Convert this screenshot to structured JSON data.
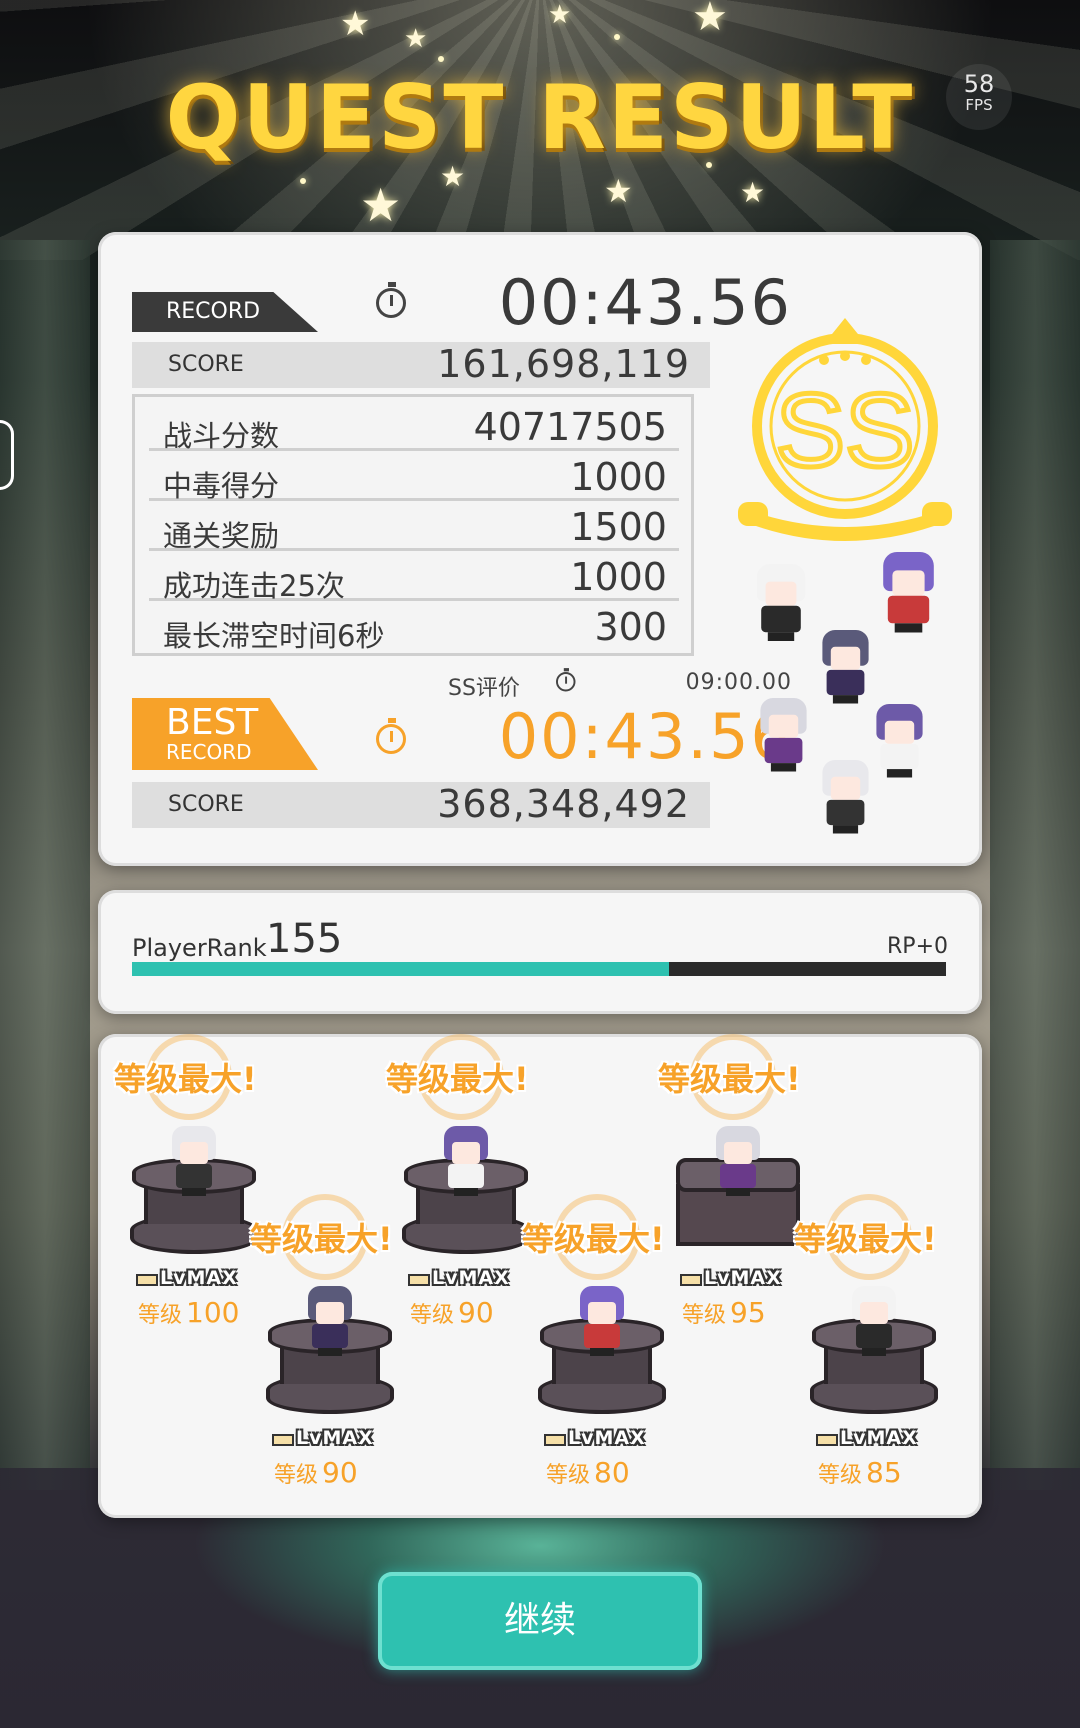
{
  "title": "QUEST RESULT",
  "fps": {
    "value": "58",
    "label": "FPS"
  },
  "record": {
    "tag": "RECORD",
    "time": "00:43.56",
    "score_label": "SCORE",
    "score": "161,698,119"
  },
  "details": [
    {
      "label": "战斗分数",
      "value": "40717505"
    },
    {
      "label": "中毒得分",
      "value": "1000"
    },
    {
      "label": "通关奖励",
      "value": "1500"
    },
    {
      "label": "成功连击25次",
      "value": "1000"
    },
    {
      "label": "最长滞空时间6秒",
      "value": "300"
    }
  ],
  "ss_condition": {
    "label": "SS评价",
    "time": "09:00.00"
  },
  "best": {
    "tag_line1": "BEST",
    "tag_line2": "RECORD",
    "time": "00:43.56",
    "score_label": "SCORE",
    "score": "368,348,492"
  },
  "grade": "SS",
  "player_rank": {
    "label": "PlayerRank",
    "value": "155",
    "rp": "RP+0",
    "progress": 0.66
  },
  "units": [
    {
      "banner": "等级最大!",
      "tag": "LvMAX",
      "level_label": "等级",
      "level": "100",
      "hair": "#e8e8ec",
      "outfit": "#333"
    },
    {
      "banner": "等级最大!",
      "tag": "LvMAX",
      "level_label": "等级",
      "level": "90",
      "hair": "#5a5a7a",
      "outfit": "#3a2f5a"
    },
    {
      "banner": "等级最大!",
      "tag": "LvMAX",
      "level_label": "等级",
      "level": "90",
      "hair": "#6d5aa8",
      "outfit": "#f3f3f3"
    },
    {
      "banner": "等级最大!",
      "tag": "LvMAX",
      "level_label": "等级",
      "level": "80",
      "hair": "#7a64c8",
      "outfit": "#c83a3a"
    },
    {
      "banner": "等级最大!",
      "tag": "LvMAX",
      "level_label": "等级",
      "level": "95",
      "hair": "#d8d8e0",
      "outfit": "#6a3a8a"
    },
    {
      "banner": "等级最大!",
      "tag": "LvMAX",
      "level_label": "等级",
      "level": "85",
      "hair": "#f3f3f3",
      "outfit": "#2a2a2a"
    }
  ],
  "continue_label": "继续",
  "colors": {
    "accent_orange": "#f7a229",
    "accent_teal": "#2ec1b0",
    "title_gold": "#ffd640"
  }
}
